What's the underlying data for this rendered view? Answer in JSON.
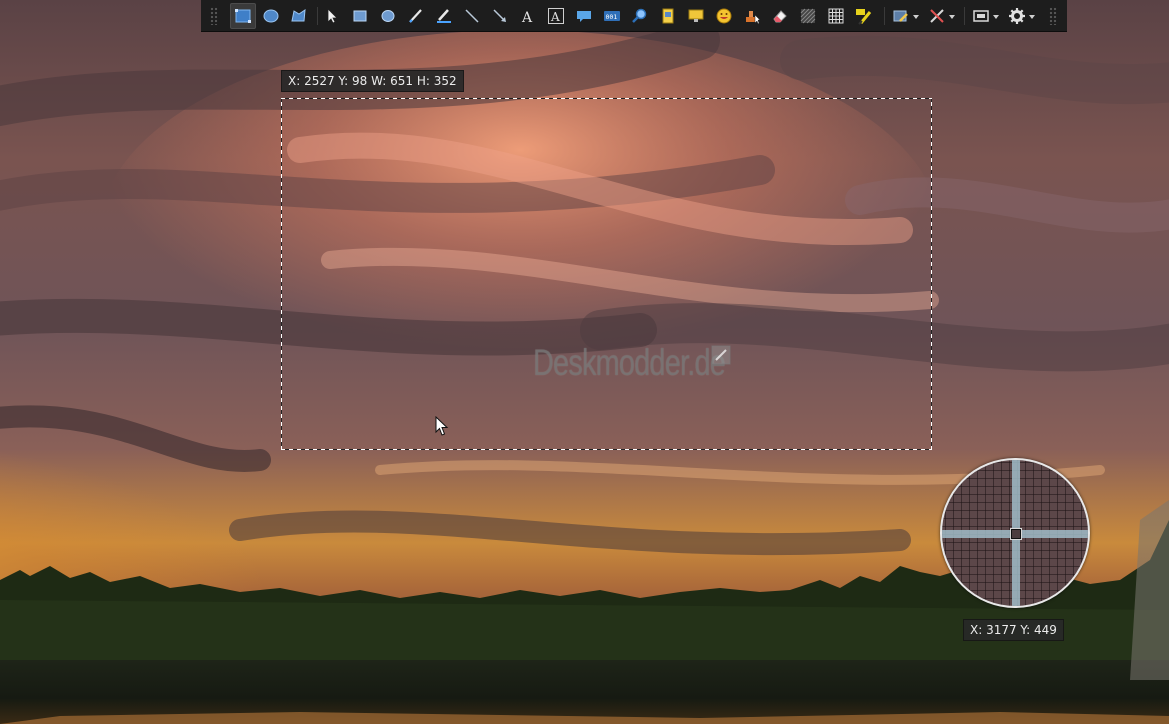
{
  "toolbar": {
    "tools": [
      {
        "name": "rectangle-region-tool",
        "icon": "rectangle-region-icon",
        "active": true
      },
      {
        "name": "ellipse-region-tool",
        "icon": "ellipse-region-icon",
        "active": false
      },
      {
        "name": "freehand-region-tool",
        "icon": "freehand-region-icon",
        "active": false
      },
      {
        "name": "select-tool",
        "icon": "pointer-icon",
        "active": false
      },
      {
        "name": "rectangle-tool",
        "icon": "rectangle-icon",
        "active": false
      },
      {
        "name": "ellipse-tool",
        "icon": "ellipse-icon",
        "active": false
      },
      {
        "name": "pen-tool",
        "icon": "pen-icon",
        "active": false
      },
      {
        "name": "highlighter-tool",
        "icon": "highlighter-icon",
        "active": false
      },
      {
        "name": "line-tool",
        "icon": "line-icon",
        "active": false
      },
      {
        "name": "arrow-tool",
        "icon": "arrow-icon",
        "active": false
      },
      {
        "name": "text-tool",
        "icon": "text-icon",
        "active": false
      },
      {
        "name": "text-outline-tool",
        "icon": "text-box-icon",
        "active": false
      },
      {
        "name": "speech-balloon-tool",
        "icon": "speech-balloon-icon",
        "active": false
      },
      {
        "name": "step-counter-tool",
        "icon": "counter-icon",
        "active": false,
        "label": "001"
      },
      {
        "name": "magnify-tool",
        "icon": "magnify-icon",
        "active": false
      },
      {
        "name": "image-file-tool",
        "icon": "image-file-icon",
        "active": false
      },
      {
        "name": "image-screen-tool",
        "icon": "screen-icon",
        "active": false
      },
      {
        "name": "sticker-tool",
        "icon": "smiley-icon",
        "active": false
      },
      {
        "name": "cursor-tool",
        "icon": "stamp-cursor-icon",
        "active": false
      },
      {
        "name": "eraser-tool",
        "icon": "eraser-icon",
        "active": false
      },
      {
        "name": "blur-tool",
        "icon": "blur-hatch-icon",
        "active": false
      },
      {
        "name": "pixelate-tool",
        "icon": "grid-icon",
        "active": false
      },
      {
        "name": "smart-eraser-tool",
        "icon": "magic-marker-icon",
        "active": false
      }
    ],
    "menus": [
      {
        "name": "edit-menu-button",
        "icon": "edit-picture-icon"
      },
      {
        "name": "tools-menu-button",
        "icon": "tools-icon"
      },
      {
        "name": "capture-menu-button",
        "icon": "capture-icon"
      },
      {
        "name": "settings-menu-button",
        "icon": "gear-icon"
      }
    ]
  },
  "selection": {
    "readout": "X: 2527 Y: 98 W: 651 H: 352"
  },
  "watermark": {
    "text": "Deskmodder.de"
  },
  "magnifier": {
    "readout": "X: 3177 Y: 449"
  },
  "colors": {
    "toolbar_bg": "#1d1d1d",
    "accent_blue": "#4aa3ff",
    "crosshair": "#a0bcc8"
  }
}
